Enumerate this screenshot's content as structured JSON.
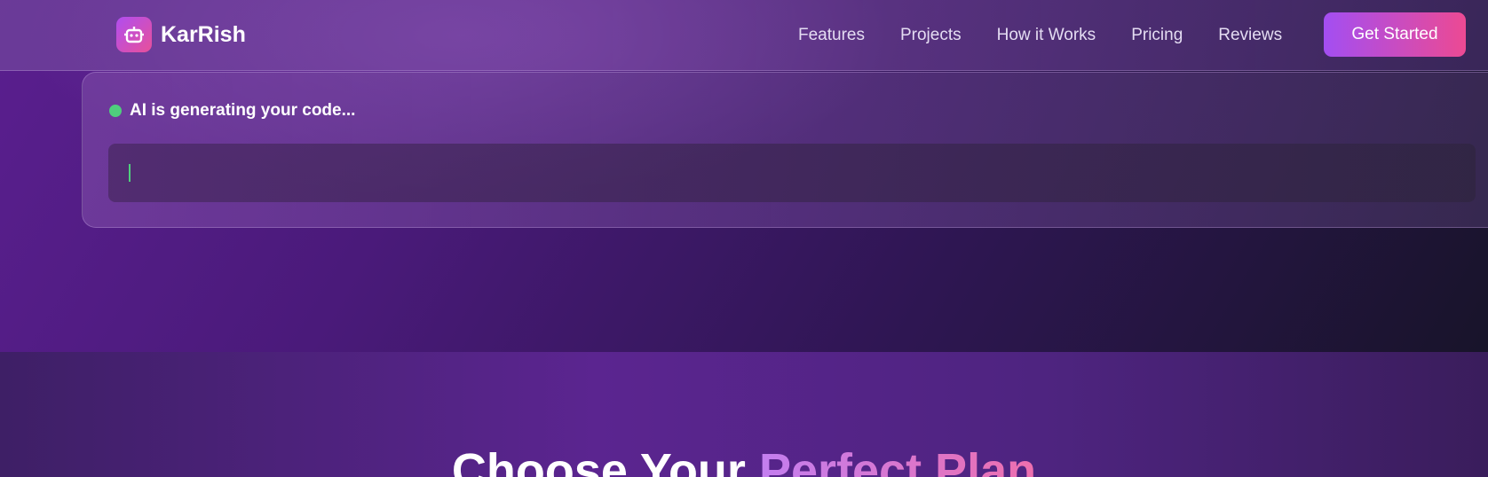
{
  "brand": {
    "name": "KarRish",
    "logo_icon": "robot-icon"
  },
  "nav": {
    "links": [
      "Features",
      "Projects",
      "How it Works",
      "Pricing",
      "Reviews"
    ],
    "cta_label": "Get Started"
  },
  "generator": {
    "status_text": "AI is generating your code...",
    "status_color": "#4fce7d"
  },
  "pricing": {
    "title_prefix": "Choose Your",
    "title_accent": "Perfect Plan"
  },
  "colors": {
    "accent_start": "#a34ef2",
    "accent_end": "#ec4a93"
  }
}
